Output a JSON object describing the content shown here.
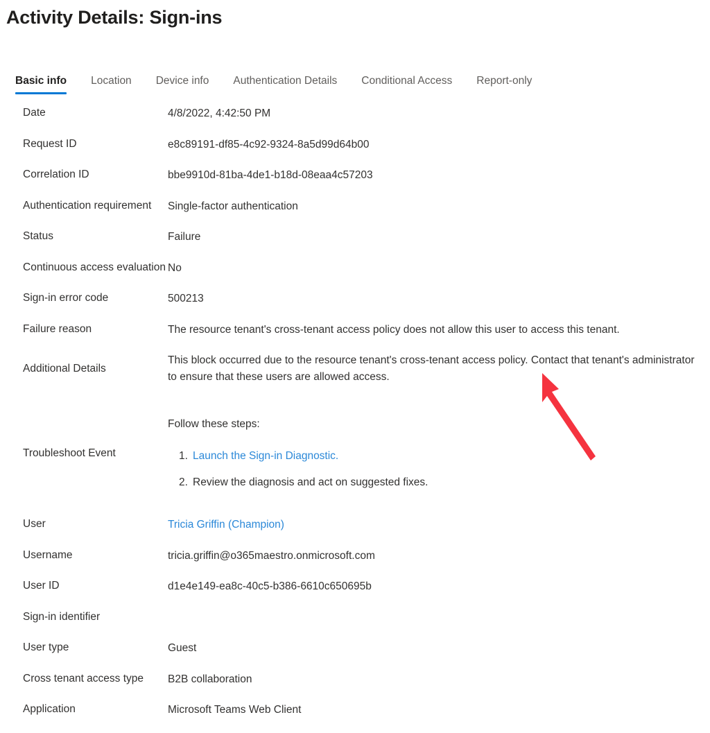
{
  "page": {
    "title": "Activity Details: Sign-ins"
  },
  "tabs": [
    {
      "label": "Basic info",
      "active": true
    },
    {
      "label": "Location",
      "active": false
    },
    {
      "label": "Device info",
      "active": false
    },
    {
      "label": "Authentication Details",
      "active": false
    },
    {
      "label": "Conditional Access",
      "active": false
    },
    {
      "label": "Report-only",
      "active": false
    }
  ],
  "basic_info": {
    "date": {
      "label": "Date",
      "value": "4/8/2022, 4:42:50 PM"
    },
    "request_id": {
      "label": "Request ID",
      "value": "e8c89191-df85-4c92-9324-8a5d99d64b00"
    },
    "correlation_id": {
      "label": "Correlation ID",
      "value": "bbe9910d-81ba-4de1-b18d-08eaa4c57203"
    },
    "authentication_requirement": {
      "label": "Authentication requirement",
      "value": "Single-factor authentication"
    },
    "status": {
      "label": "Status",
      "value": "Failure"
    },
    "continuous_access_evaluation": {
      "label": "Continuous access evaluation",
      "value": "No"
    },
    "sign_in_error_code": {
      "label": "Sign-in error code",
      "value": "500213"
    },
    "failure_reason": {
      "label": "Failure reason",
      "value": "The resource tenant's cross-tenant access policy does not allow this user to access this tenant."
    },
    "additional_details": {
      "label": "Additional Details",
      "value": "This block occurred due to the resource tenant's cross-tenant access policy. Contact that tenant's administrator to ensure that these users are allowed access."
    },
    "troubleshoot_event": {
      "label": "Troubleshoot Event",
      "intro": "Follow these steps:",
      "step_1_link": "Launch the Sign-in Diagnostic.",
      "step_2": "Review the diagnosis and act on suggested fixes."
    },
    "user": {
      "label": "User",
      "value": "Tricia Griffin (Champion)"
    },
    "username": {
      "label": "Username",
      "value": "tricia.griffin@o365maestro.onmicrosoft.com"
    },
    "user_id": {
      "label": "User ID",
      "value": "d1e4e149-ea8c-40c5-b386-6610c650695b"
    },
    "sign_in_identifier": {
      "label": "Sign-in identifier",
      "value": ""
    },
    "user_type": {
      "label": "User type",
      "value": "Guest"
    },
    "cross_tenant_access_type": {
      "label": "Cross tenant access type",
      "value": "B2B collaboration"
    },
    "application": {
      "label": "Application",
      "value": "Microsoft Teams Web Client"
    }
  },
  "colors": {
    "accent": "#0078d4",
    "link": "#2b88d8",
    "text": "#323130",
    "muted_text": "#605e5c",
    "annotation": "#f5333f",
    "background": "#ffffff"
  }
}
